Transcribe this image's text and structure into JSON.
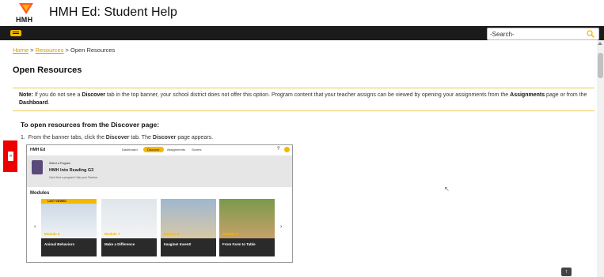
{
  "header": {
    "logo_text": "HMH",
    "title": "HMH Ed: Student Help"
  },
  "search": {
    "placeholder": "-Search-"
  },
  "breadcrumb": {
    "home": "Home",
    "sep1": ">",
    "resources": "Resources",
    "sep2": ">",
    "current": "Open Resources"
  },
  "page": {
    "title": "Open Resources",
    "note_label": "Note:",
    "note_text_1": " If you do not see a ",
    "note_discover": "Discover",
    "note_text_2": " tab in the top banner, your school district does not offer this option. Program content that your teacher assigns can be viewed by opening your assignments from the ",
    "note_assignments": "Assignments",
    "note_text_3": " page or from the ",
    "note_dashboard": "Dashboard",
    "note_text_4": ".",
    "section_heading": "To open resources from the Discover page:",
    "step_num": "1.",
    "step_text_1": "From the banner tabs, click the ",
    "step_discover": "Discover",
    "step_text_2": " tab. The ",
    "step_discover2": "Discover",
    "step_text_3": " page appears."
  },
  "screenshot": {
    "brand": "HMH Ed",
    "tabs": [
      "Dashboard",
      "Discover",
      "Assignments",
      "Scores"
    ],
    "select_label": "Select a Program",
    "program_title": "HMH Into Reading G3",
    "cant_find": "Can't find a program? Ask your Teacher",
    "modules_label": "Modules",
    "last_viewed": "LAST VIEWED",
    "cards": [
      {
        "module": "Module 6",
        "label": "Animal Behaviors"
      },
      {
        "module": "Module 7",
        "label": "Make a Difference"
      },
      {
        "module": "Module 8",
        "label": "Imagine! Invent!"
      },
      {
        "module": "Module 9",
        "label": "From Farm to Table"
      }
    ]
  },
  "colors": {
    "accent": "#f5b800",
    "navbar": "#1b1b1b",
    "link": "#d29a00",
    "side_tab": "#ee0000"
  },
  "icons": {
    "search": "search-icon",
    "nav": "menu-icon",
    "side": "expand-icon",
    "top": "arrow-up-icon"
  }
}
